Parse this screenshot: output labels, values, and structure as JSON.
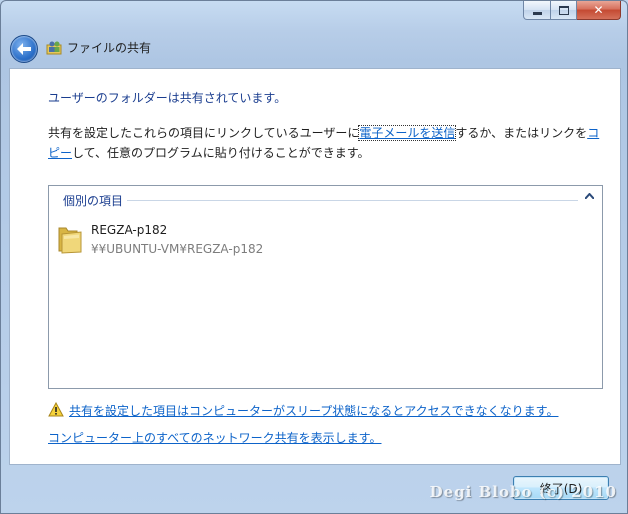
{
  "window": {
    "title": "ファイルの共有",
    "close_glyph": "✕"
  },
  "content": {
    "heading": "ユーザーのフォルダーは共有されています。",
    "desc_part1": "共有を設定したこれらの項目にリンクしているユーザーに",
    "desc_link_email": "電子メールを送信",
    "desc_part2": "するか、またはリンクを",
    "desc_link_copy": "コピー",
    "desc_part3": "して、任意のプログラムに貼り付けることができます。",
    "group_header": "個別の項目",
    "item": {
      "name": "REGZA-p182",
      "path": "¥¥UBUNTU-VM¥REGZA-p182"
    },
    "warning_link": "共有を設定した項目はコンピューターがスリープ状態になるとアクセスできなくなります。",
    "network_link": "コンピューター上のすべてのネットワーク共有を表示します。"
  },
  "footer": {
    "close_button": "終了(D)",
    "watermark": "Degi Blobo (c) 2010"
  },
  "icons": {
    "back": "back-arrow-icon",
    "share": "share-icon",
    "folder": "folder-icon",
    "warning": "warning-icon",
    "collapse": "chevron-up-icon"
  },
  "colors": {
    "link": "#0d63c9",
    "heading": "#1a3d8f"
  }
}
